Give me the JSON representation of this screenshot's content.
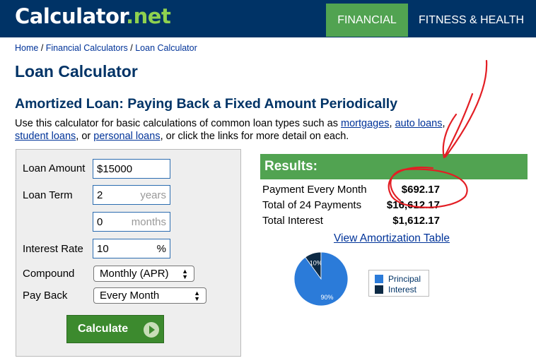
{
  "header": {
    "logo_main": "Calculator",
    "logo_dot": ".",
    "logo_net": "net",
    "nav": [
      "FINANCIAL",
      "FITNESS & HEALTH"
    ]
  },
  "breadcrumb": {
    "home": "Home",
    "sep": " / ",
    "financial": "Financial Calculators",
    "current": "Loan Calculator"
  },
  "page_title": "Loan Calculator",
  "sub_title": "Amortized Loan: Paying Back a Fixed Amount Periodically",
  "intro": {
    "lead": "Use this calculator for basic calculations of common loan types such as ",
    "link_mortgages": "mortgages",
    "comma1": ", ",
    "link_auto": "auto loans",
    "comma2": ", ",
    "link_student": "student loans",
    "or": ", or ",
    "link_personal": "personal loans",
    "tail": ", or click the links for more detail on each."
  },
  "form": {
    "loan_amount_label": "Loan Amount",
    "loan_amount_value": "$15000",
    "loan_term_label": "Loan Term",
    "term_years_value": "2",
    "term_years_unit": "years",
    "term_months_value": "0",
    "term_months_unit": "months",
    "interest_rate_label": "Interest Rate",
    "interest_rate_value": "10",
    "interest_rate_unit": "%",
    "compound_label": "Compound",
    "compound_value": "Monthly (APR)",
    "payback_label": "Pay Back",
    "payback_value": "Every Month",
    "calculate_label": "Calculate"
  },
  "results": {
    "header": "Results:",
    "rows": [
      {
        "label": "Payment Every Month",
        "value": "$692.17"
      },
      {
        "label": "Total of 24 Payments",
        "value": "$16,612.17"
      },
      {
        "label": "Total Interest",
        "value": "$1,612.17"
      }
    ],
    "amortization_link": "View Amortization Table"
  },
  "chart_data": {
    "type": "pie",
    "slices": [
      {
        "name": "Principal",
        "value": 90,
        "label": "90%",
        "color": "#2b7bd9"
      },
      {
        "name": "Interest",
        "value": 10,
        "label": "10%",
        "color": "#0d2a45"
      }
    ],
    "legend_placement": "right"
  },
  "colors": {
    "header_bg": "#003366",
    "accent_green": "#51a351",
    "link_blue": "#003399",
    "annotation_red": "#e31e24"
  }
}
